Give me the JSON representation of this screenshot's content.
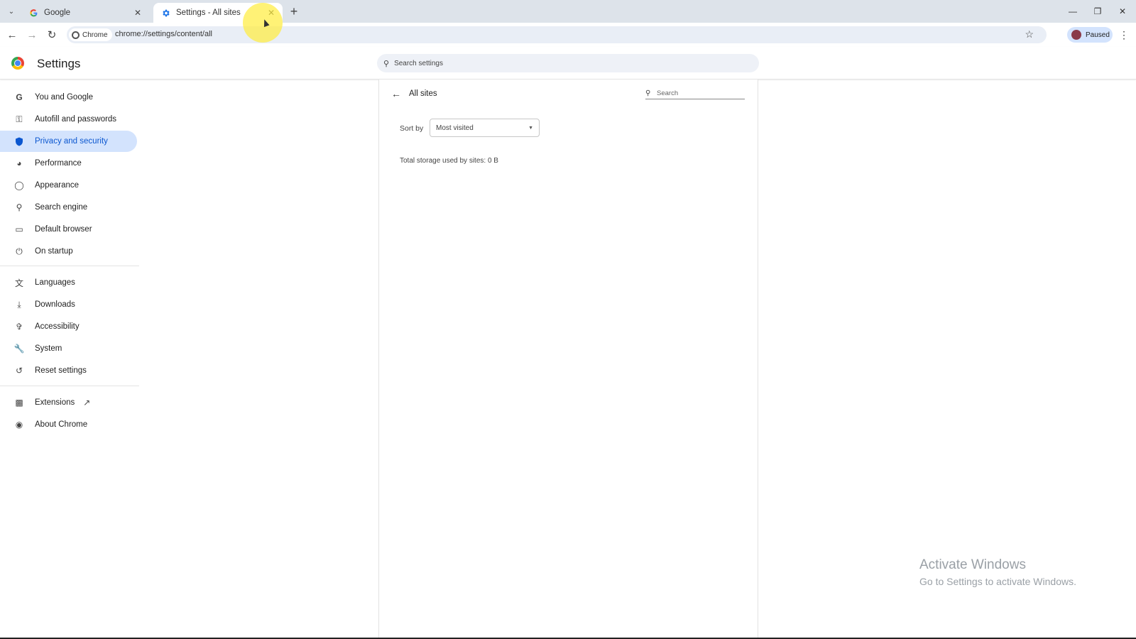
{
  "tabs": [
    {
      "label": "Google",
      "active": false,
      "favicon": "google-g-icon"
    },
    {
      "label": "Settings - All sites",
      "active": true,
      "favicon": "gear-icon"
    }
  ],
  "toolbar": {
    "chip_label": "Chrome",
    "url": "chrome://settings/content/all",
    "profile_label": "Paused"
  },
  "header": {
    "title": "Settings",
    "search_placeholder": "Search settings"
  },
  "sidebar": {
    "items": [
      {
        "label": "You and Google",
        "icon": "google-g-icon"
      },
      {
        "label": "Autofill and passwords",
        "icon": "key-icon"
      },
      {
        "label": "Privacy and security",
        "icon": "shield-icon",
        "selected": true
      },
      {
        "label": "Performance",
        "icon": "speedometer-icon"
      },
      {
        "label": "Appearance",
        "icon": "palette-icon"
      },
      {
        "label": "Search engine",
        "icon": "search-icon"
      },
      {
        "label": "Default browser",
        "icon": "browser-window-icon"
      },
      {
        "label": "On startup",
        "icon": "power-icon"
      },
      {
        "label": "Languages",
        "icon": "translate-icon"
      },
      {
        "label": "Downloads",
        "icon": "download-icon"
      },
      {
        "label": "Accessibility",
        "icon": "accessibility-icon"
      },
      {
        "label": "System",
        "icon": "wrench-icon"
      },
      {
        "label": "Reset settings",
        "icon": "reset-icon"
      },
      {
        "label": "Extensions",
        "icon": "puzzle-icon"
      },
      {
        "label": "About Chrome",
        "icon": "chrome-icon"
      }
    ]
  },
  "main": {
    "heading": "All sites",
    "search_placeholder": "Search",
    "sort_label": "Sort by",
    "sort_value": "Most visited",
    "storage_text": "Total storage used by sites: 0 B"
  },
  "watermark": {
    "line1": "Activate Windows",
    "line2": "Go to Settings to activate Windows."
  },
  "colors": {
    "accent": "#0b57d0",
    "selected_bg": "#d3e3fd",
    "tabstrip_bg": "#dde3ea"
  }
}
